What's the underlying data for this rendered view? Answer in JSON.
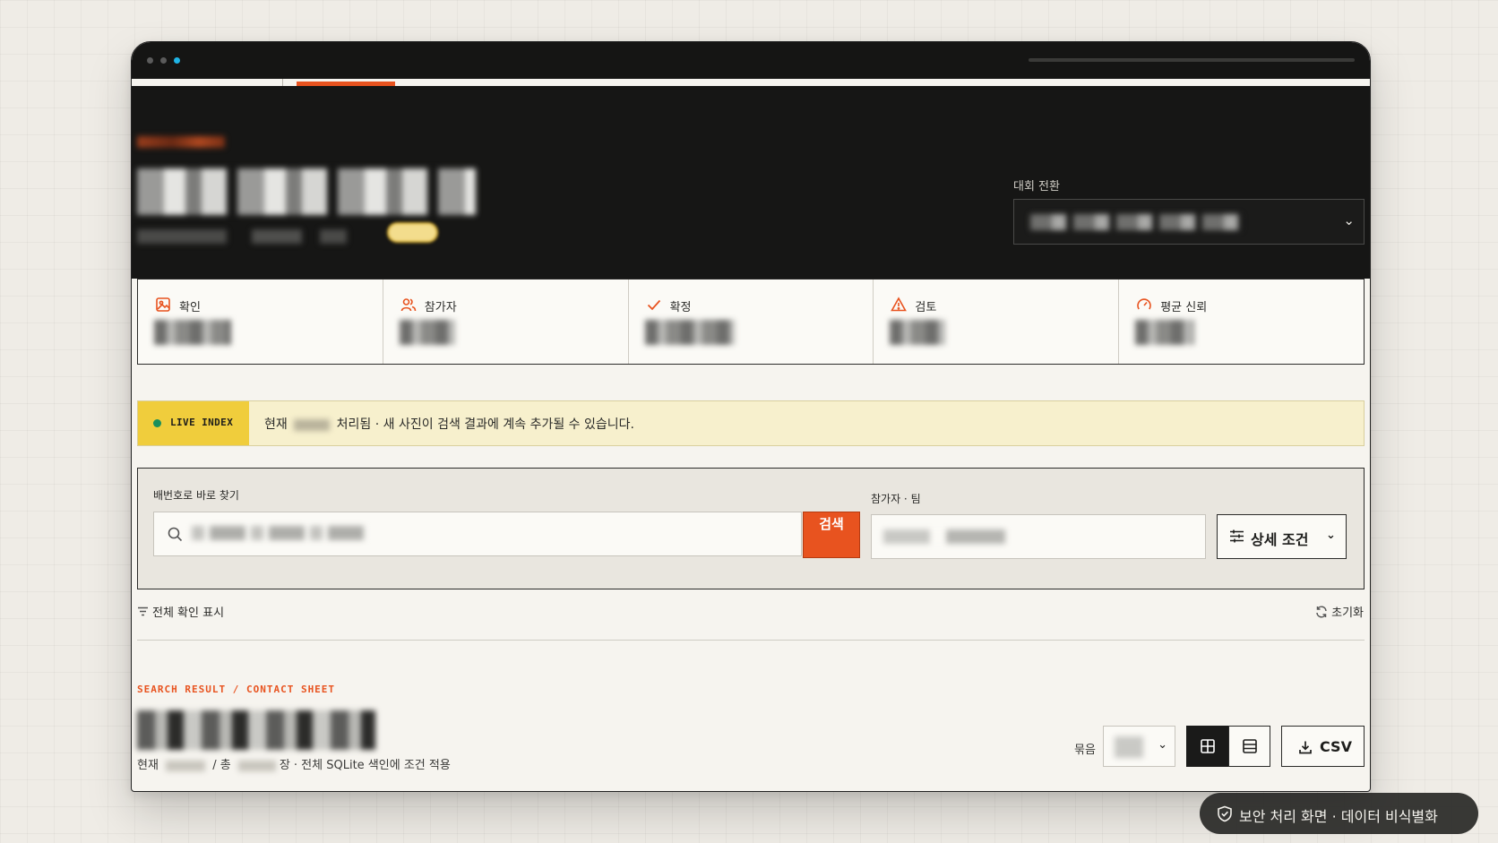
{
  "hero": {
    "switch_label": "대회 전환",
    "switch_chevron": "⌄"
  },
  "stats": [
    {
      "label": "확인",
      "icon": "image-icon"
    },
    {
      "label": "참가자",
      "icon": "users-icon"
    },
    {
      "label": "확정",
      "icon": "check-icon"
    },
    {
      "label": "검토",
      "icon": "alert-icon"
    },
    {
      "label": "평균 신뢰",
      "icon": "gauge-icon"
    }
  ],
  "live": {
    "tag": "LIVE INDEX",
    "prefix": "현재",
    "suffix": "처리됨 · 새 사진이 검색 결과에 계속 추가될 수 있습니다."
  },
  "search": {
    "bib_label": "배번호로 바로 찾기",
    "search_button": "검색",
    "participant_label": "참가자 · 팀",
    "advanced_button": "상세 조건",
    "advanced_chevron": "⌄"
  },
  "filter": {
    "show_all": "전체 확인 표시",
    "reset": "초기화"
  },
  "results": {
    "kicker": "SEARCH RESULT / CONTACT SHEET",
    "sub_prefix": "현재",
    "sub_mid": "/ 총",
    "sub_suffix": "장 · 전체 SQLite 색인에 조건 적용",
    "group_label": "묶음",
    "csv_label": "CSV"
  },
  "security_badge": "보안 처리 화면 · 데이터 비식별화",
  "colors": {
    "accent": "#e8531f",
    "live_yellow": "#f0cd3c",
    "dark": "#161615"
  }
}
